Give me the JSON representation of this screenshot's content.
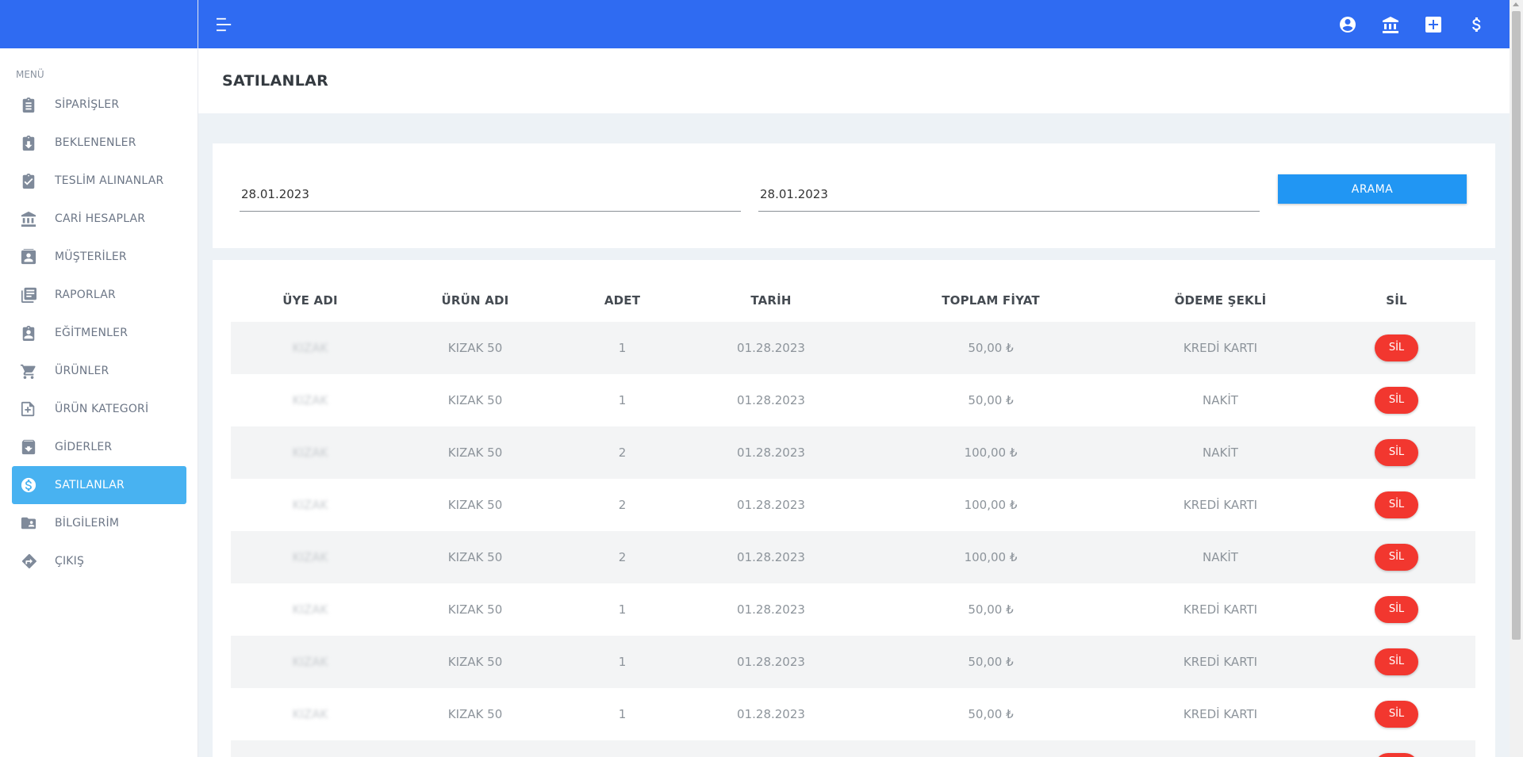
{
  "sidebar": {
    "menu_title": "MENÜ",
    "items": [
      {
        "label": "SİPARİŞLER",
        "icon": "clipboard-text-icon"
      },
      {
        "label": "BEKLENENLER",
        "icon": "clipboard-download-icon"
      },
      {
        "label": "TESLİM ALINANLAR",
        "icon": "clipboard-check-icon"
      },
      {
        "label": "CARİ HESAPLAR",
        "icon": "bank-icon"
      },
      {
        "label": "MÜŞTERİLER",
        "icon": "contact-card-icon"
      },
      {
        "label": "RAPORLAR",
        "icon": "library-books-icon"
      },
      {
        "label": "EĞİTMENLER",
        "icon": "clipboard-account-icon"
      },
      {
        "label": "ÜRÜNLER",
        "icon": "cart-icon"
      },
      {
        "label": "ÜRÜN KATEGORİ",
        "icon": "note-plus-icon"
      },
      {
        "label": "GİDERLER",
        "icon": "archive-icon"
      },
      {
        "label": "SATILANLAR",
        "icon": "dollar-circle-icon",
        "active": true
      },
      {
        "label": "BİLGİLERİM",
        "icon": "folder-account-icon"
      },
      {
        "label": "ÇIKIŞ",
        "icon": "directions-icon"
      }
    ]
  },
  "topbar": {
    "icons": [
      "account-circle-icon",
      "bank-icon",
      "plus-box-icon",
      "dollar-icon"
    ]
  },
  "page": {
    "title": "SATILANLAR"
  },
  "filter": {
    "start_date": "28.01.2023",
    "end_date": "28.01.2023",
    "search_label": "ARAMA"
  },
  "table": {
    "headers": [
      "ÜYE ADI",
      "ÜRÜN ADI",
      "ADET",
      "TARİH",
      "TOPLAM FİYAT",
      "ÖDEME ŞEKLİ",
      "SİL"
    ],
    "delete_label": "SİL",
    "rows": [
      {
        "member": "KIZAK",
        "product": "KIZAK 50",
        "qty": "1",
        "date": "01.28.2023",
        "total": "50,00 ₺",
        "payment": "KREDİ KARTI"
      },
      {
        "member": "KIZAK",
        "product": "KIZAK 50",
        "qty": "1",
        "date": "01.28.2023",
        "total": "50,00 ₺",
        "payment": "NAKİT"
      },
      {
        "member": "KIZAK",
        "product": "KIZAK 50",
        "qty": "2",
        "date": "01.28.2023",
        "total": "100,00 ₺",
        "payment": "NAKİT"
      },
      {
        "member": "KIZAK",
        "product": "KIZAK 50",
        "qty": "2",
        "date": "01.28.2023",
        "total": "100,00 ₺",
        "payment": "KREDİ KARTI"
      },
      {
        "member": "KIZAK",
        "product": "KIZAK 50",
        "qty": "2",
        "date": "01.28.2023",
        "total": "100,00 ₺",
        "payment": "NAKİT"
      },
      {
        "member": "KIZAK",
        "product": "KIZAK 50",
        "qty": "1",
        "date": "01.28.2023",
        "total": "50,00 ₺",
        "payment": "KREDİ KARTI"
      },
      {
        "member": "KIZAK",
        "product": "KIZAK 50",
        "qty": "1",
        "date": "01.28.2023",
        "total": "50,00 ₺",
        "payment": "KREDİ KARTI"
      },
      {
        "member": "KIZAK",
        "product": "KIZAK 50",
        "qty": "1",
        "date": "01.28.2023",
        "total": "50,00 ₺",
        "payment": "KREDİ KARTI"
      },
      {
        "member": "",
        "product": "",
        "qty": "",
        "date": "",
        "total": "",
        "payment": ""
      }
    ]
  },
  "colors": {
    "topbar": "#2f6bf2",
    "active_nav": "#48b2f1",
    "search_button": "#2196f3",
    "delete_button": "#f2372f"
  }
}
